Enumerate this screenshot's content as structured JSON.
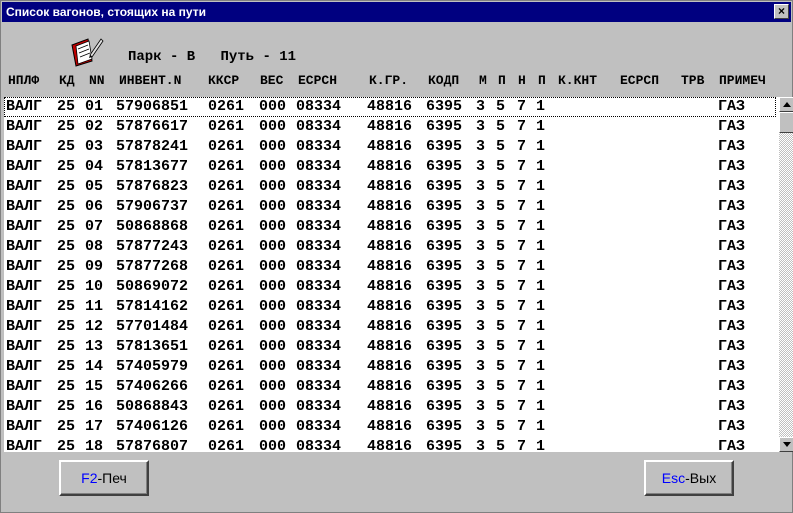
{
  "window": {
    "title": "Список вагонов, стоящих на пути",
    "close_label": "×"
  },
  "header": {
    "park_label": "Парк - В",
    "track_label": "Путь - 11",
    "icon": "notebook-pencil-icon"
  },
  "columns": [
    "НПЛФ",
    "КД",
    "NN",
    "ИНВЕНТ.N",
    "ККСР",
    "ВЕС",
    "ЕСРСН",
    "К.ГР.",
    "КОДП",
    "М",
    "П",
    "Н",
    "П",
    "К.КНТ",
    "ЕСРСП",
    "ТРВ",
    "ПРИМЕЧ"
  ],
  "rows": [
    [
      "ВАЛГ",
      "25",
      "01",
      "57906851",
      "0261",
      "000",
      "08334",
      "48816",
      "6395",
      "3",
      "5",
      "7",
      "1",
      "ГАЗ"
    ],
    [
      "ВАЛГ",
      "25",
      "02",
      "57876617",
      "0261",
      "000",
      "08334",
      "48816",
      "6395",
      "3",
      "5",
      "7",
      "1",
      "ГАЗ"
    ],
    [
      "ВАЛГ",
      "25",
      "03",
      "57878241",
      "0261",
      "000",
      "08334",
      "48816",
      "6395",
      "3",
      "5",
      "7",
      "1",
      "ГАЗ"
    ],
    [
      "ВАЛГ",
      "25",
      "04",
      "57813677",
      "0261",
      "000",
      "08334",
      "48816",
      "6395",
      "3",
      "5",
      "7",
      "1",
      "ГАЗ"
    ],
    [
      "ВАЛГ",
      "25",
      "05",
      "57876823",
      "0261",
      "000",
      "08334",
      "48816",
      "6395",
      "3",
      "5",
      "7",
      "1",
      "ГАЗ"
    ],
    [
      "ВАЛГ",
      "25",
      "06",
      "57906737",
      "0261",
      "000",
      "08334",
      "48816",
      "6395",
      "3",
      "5",
      "7",
      "1",
      "ГАЗ"
    ],
    [
      "ВАЛГ",
      "25",
      "07",
      "50868868",
      "0261",
      "000",
      "08334",
      "48816",
      "6395",
      "3",
      "5",
      "7",
      "1",
      "ГАЗ"
    ],
    [
      "ВАЛГ",
      "25",
      "08",
      "57877243",
      "0261",
      "000",
      "08334",
      "48816",
      "6395",
      "3",
      "5",
      "7",
      "1",
      "ГАЗ"
    ],
    [
      "ВАЛГ",
      "25",
      "09",
      "57877268",
      "0261",
      "000",
      "08334",
      "48816",
      "6395",
      "3",
      "5",
      "7",
      "1",
      "ГАЗ"
    ],
    [
      "ВАЛГ",
      "25",
      "10",
      "50869072",
      "0261",
      "000",
      "08334",
      "48816",
      "6395",
      "3",
      "5",
      "7",
      "1",
      "ГАЗ"
    ],
    [
      "ВАЛГ",
      "25",
      "11",
      "57814162",
      "0261",
      "000",
      "08334",
      "48816",
      "6395",
      "3",
      "5",
      "7",
      "1",
      "ГАЗ"
    ],
    [
      "ВАЛГ",
      "25",
      "12",
      "57701484",
      "0261",
      "000",
      "08334",
      "48816",
      "6395",
      "3",
      "5",
      "7",
      "1",
      "ГАЗ"
    ],
    [
      "ВАЛГ",
      "25",
      "13",
      "57813651",
      "0261",
      "000",
      "08334",
      "48816",
      "6395",
      "3",
      "5",
      "7",
      "1",
      "ГАЗ"
    ],
    [
      "ВАЛГ",
      "25",
      "14",
      "57405979",
      "0261",
      "000",
      "08334",
      "48816",
      "6395",
      "3",
      "5",
      "7",
      "1",
      "ГАЗ"
    ],
    [
      "ВАЛГ",
      "25",
      "15",
      "57406266",
      "0261",
      "000",
      "08334",
      "48816",
      "6395",
      "3",
      "5",
      "7",
      "1",
      "ГАЗ"
    ],
    [
      "ВАЛГ",
      "25",
      "16",
      "50868843",
      "0261",
      "000",
      "08334",
      "48816",
      "6395",
      "3",
      "5",
      "7",
      "1",
      "ГАЗ"
    ],
    [
      "ВАЛГ",
      "25",
      "17",
      "57406126",
      "0261",
      "000",
      "08334",
      "48816",
      "6395",
      "3",
      "5",
      "7",
      "1",
      "ГАЗ"
    ],
    [
      "ВАЛГ",
      "25",
      "18",
      "57876807",
      "0261",
      "000",
      "08334",
      "48816",
      "6395",
      "3",
      "5",
      "7",
      "1",
      "ГАЗ"
    ]
  ],
  "buttons": {
    "print": {
      "key": "F2",
      "sep": "-",
      "label": "Печ"
    },
    "exit": {
      "key": "Esc",
      "sep": "-",
      "label": "Вых"
    }
  },
  "colors": {
    "title_bg": "#000080",
    "button_key": "#0000ff",
    "face": "#c0c0c0"
  }
}
